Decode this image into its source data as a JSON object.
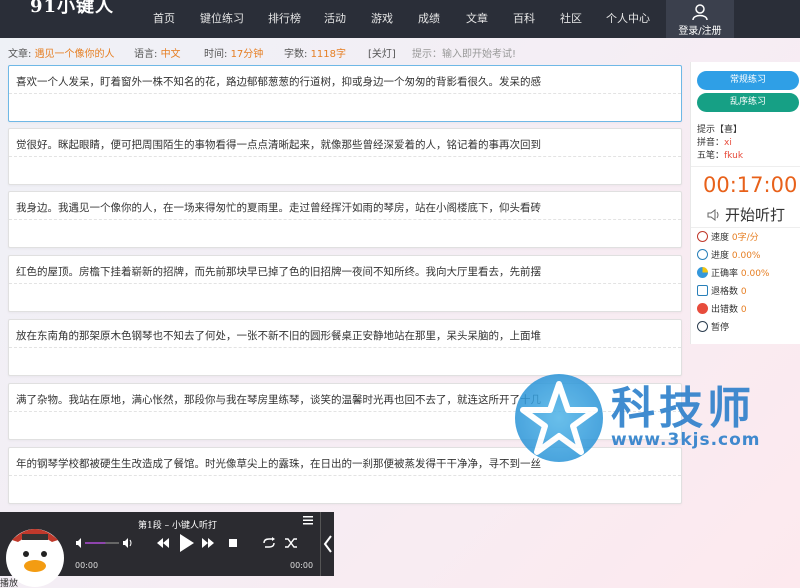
{
  "nav": {
    "logo": "91小键人",
    "items": [
      "首页",
      "键位练习",
      "排行榜",
      "活动",
      "游戏",
      "成绩",
      "文章",
      "百科",
      "社区",
      "个人中心"
    ],
    "login": "登录/注册"
  },
  "info": {
    "article_label": "文章:",
    "article_value": "遇见一个像你的人",
    "lang_label": "语言:",
    "lang_value": "中文",
    "time_label": "时间:",
    "time_value": "17分钟",
    "chars_label": "字数:",
    "chars_value": "1118字",
    "close_link": "[关灯]",
    "tip": "提示：输入即开始考试!"
  },
  "blocks": [
    "喜欢一个人发呆，盯着窗外一株不知名的花，路边郁郁葱葱的行道树，抑或身边一个匆匆的背影看很久。发呆的感",
    "觉很好。眯起眼睛，便可把周围陌生的事物看得一点点清晰起来，就像那些曾经深爱着的人，铭记着的事再次回到",
    "我身边。我遇见一个像你的人，在一场来得匆忙的夏雨里。走过曾经挥汗如雨的琴房，站在小阁楼底下，仰头看砖",
    "红色的屋顶。房檐下挂着崭新的招牌，而先前那块早已掉了色的旧招牌一夜间不知所终。我向大厅里看去，先前摆",
    "放在东南角的那架原木色钢琴也不知去了何处，一张不新不旧的圆形餐桌正安静地站在那里，呆头呆脑的，上面堆",
    "满了杂物。我站在原地，满心怅然，那段你与我在琴房里练琴，谈笑的温馨时光再也回不去了，就连这所开了十几",
    "年的钢琴学校都被硬生生改造成了餐馆。时光像草尖上的露珠，在日出的一刹那便被蒸发得干干净净，寻不到一丝"
  ],
  "panel": {
    "btn_normal": "常规练习",
    "btn_random": "乱序练习",
    "hint_label": "提示【喜】",
    "pinyin_label": "拼音：",
    "pinyin_value": "xi",
    "wubi_label": "五笔：",
    "wubi_value": "fkuk",
    "timer": "00:17:00",
    "listen": "开始听打",
    "stats": [
      {
        "label": "速度",
        "value": "0字/分"
      },
      {
        "label": "进度",
        "value": "0.00%"
      },
      {
        "label": "正确率",
        "value": "0.00%"
      },
      {
        "label": "退格数",
        "value": "0"
      },
      {
        "label": "出错数",
        "value": "0"
      },
      {
        "label": "暂停",
        "value": ""
      }
    ]
  },
  "watermark": {
    "title": "科技师",
    "url": "www.3kjs.com"
  },
  "player": {
    "title": "第1段 – 小键人听打",
    "time_left": "00:00",
    "time_right": "00:00",
    "volume_fraction": 0.6,
    "footer": "播放"
  },
  "colors": {
    "nav_bg": "#2a2e38",
    "accent_orange": "#e67e22",
    "timer": "#e8611a",
    "btn_blue": "#2f9fe6",
    "btn_green": "#16a085"
  }
}
